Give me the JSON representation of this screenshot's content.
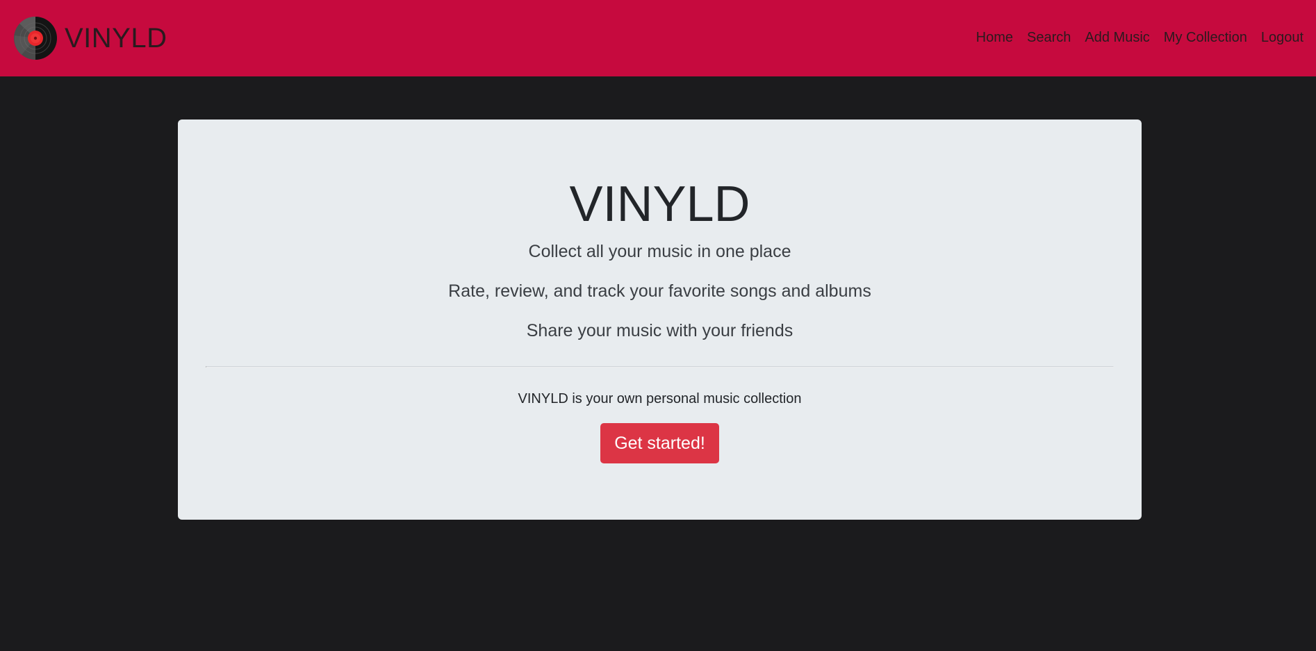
{
  "navbar": {
    "brand_name": "VINYLD",
    "logo_icon": "vinyl-record-icon",
    "links": [
      {
        "label": "Home"
      },
      {
        "label": "Search"
      },
      {
        "label": "Add Music"
      },
      {
        "label": "My Collection"
      },
      {
        "label": "Logout"
      }
    ],
    "colors": {
      "background": "#c60a3e",
      "text": "#2a1a1e"
    }
  },
  "hero": {
    "title": "VINYLD",
    "leads": [
      "Collect all your music in one place",
      "Rate, review, and track your favorite songs and albums",
      "Share your music with your friends"
    ],
    "tagline": "VINYLD is your own personal music collection",
    "cta_label": "Get started!",
    "colors": {
      "background": "#e8ecef",
      "cta": "#dc3545",
      "page": "#1b1b1d"
    }
  }
}
